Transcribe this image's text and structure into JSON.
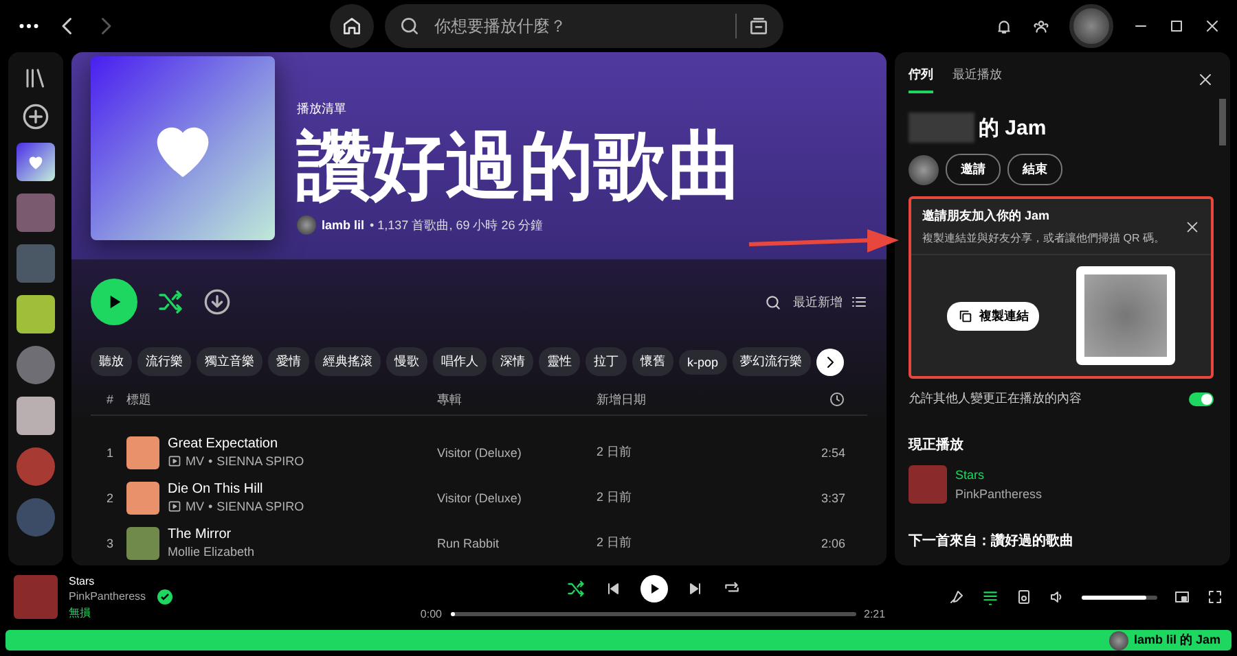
{
  "top_bar": {
    "search": {
      "placeholder": "你想要播放什麼？"
    }
  },
  "sidebar": {
    "items": [
      {
        "kind": "liked"
      },
      {
        "kind": "square",
        "color": "#7a5a6e"
      },
      {
        "kind": "square",
        "color": "#4a5866"
      },
      {
        "kind": "square",
        "color": "#9fbf3a"
      },
      {
        "kind": "circle",
        "color": "#6e6e74"
      },
      {
        "kind": "square",
        "color": "#b9aeb0"
      },
      {
        "kind": "circle",
        "color": "#a83a34"
      },
      {
        "kind": "circle",
        "color": "#3c4c66"
      }
    ]
  },
  "playlist": {
    "type": "播放清單",
    "title": "讚好過的歌曲",
    "owner": "lamb lil",
    "stats": "• 1,137 首歌曲, 69 小時 26 分鐘",
    "shuffle_on": true,
    "sort": "最近新增",
    "chips": [
      "聽放",
      "流行樂",
      "獨立音樂",
      "愛情",
      "經典搖滾",
      "慢歌",
      "唱作人",
      "深情",
      "靈性",
      "拉丁",
      "懷舊",
      "k-pop",
      "夢幻流行樂"
    ],
    "columns": [
      "#",
      "標題",
      "專輯",
      "新增日期"
    ],
    "rows": [
      {
        "index": "1",
        "title": "Great Expectation",
        "video": true,
        "video_label": "MV",
        "separator": "•",
        "artist": "SIENNA SPIRO",
        "album": "Visitor (Deluxe)",
        "added": "2 日前",
        "duration": "2:54",
        "color": "#e8916a"
      },
      {
        "index": "2",
        "title": "Die On This Hill",
        "video": true,
        "video_label": "MV",
        "separator": "•",
        "artist": "SIENNA SPIRO",
        "album": "Visitor (Deluxe)",
        "added": "2 日前",
        "duration": "3:37",
        "color": "#e8916a"
      },
      {
        "index": "3",
        "title": "The Mirror",
        "video": false,
        "artist": "Mollie Elizabeth",
        "album": "Run Rabbit",
        "added": "2 日前",
        "duration": "2:06",
        "color": "#6f8a4a"
      }
    ]
  },
  "right_panel": {
    "tabs": [
      {
        "label": "佇列",
        "selected": true
      },
      {
        "label": "最近播放",
        "selected": false
      }
    ],
    "jam_title": "的 Jam",
    "jam_buttons": [
      "邀請",
      "結束"
    ],
    "invite": {
      "title": "邀請朋友加入你的 Jam",
      "description": "複製連結並與好友分享，或者讓他們掃描 QR 碼。",
      "copy_button": "複製連結"
    },
    "allow_control": {
      "label": "允許其他人變更正在播放的內容",
      "on": true
    },
    "now_playing": {
      "heading": "現正播放",
      "title": "Stars",
      "artist": "PinkPantheress"
    },
    "next_from": "下一首來自：讚好過的歌曲"
  },
  "player": {
    "title": "Stars",
    "artist": "PinkPantheress",
    "quality": "無損",
    "liked": true,
    "shuffle": true,
    "elapsed": "0:00",
    "total": "2:21",
    "progress": {
      "level": 0.0
    },
    "volume": {
      "level": 0.85
    },
    "queue_open": true
  },
  "jam_bar": {
    "label": "lamb lil 的 Jam"
  }
}
